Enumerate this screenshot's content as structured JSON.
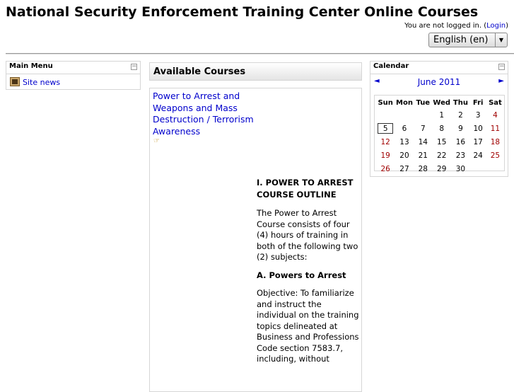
{
  "header": {
    "site_title": "National Security Enforcement Training Center Online Courses",
    "login_text": "You are not logged in. (",
    "login_link": "Login",
    "login_close": ")",
    "language": "English (en)"
  },
  "main_menu": {
    "title": "Main Menu",
    "items": [
      {
        "label": "Site news",
        "icon": "news-icon"
      }
    ]
  },
  "courses": {
    "header": "Available Courses",
    "course_title": "Power to Arrest and Weapons and Mass Destruction / Terrorism Awareness",
    "summary": {
      "heading": "I. POWER TO ARREST COURSE OUTLINE",
      "intro": "The Power to Arrest Course consists of four (4) hours of training in both of the following two (2) subjects:",
      "subheading": "A. Powers to Arrest",
      "objective": "Objective: To familiarize and instruct the individual on the training topics delineated at Business and Professions Code section 7583.7, including, without"
    }
  },
  "calendar": {
    "title": "Calendar",
    "month": "June 2011",
    "prev": "◄",
    "next": "►",
    "days": [
      "Sun",
      "Mon",
      "Tue",
      "Wed",
      "Thu",
      "Fri",
      "Sat"
    ],
    "weeks": [
      [
        "",
        "",
        "",
        "1",
        "2",
        "3",
        "4"
      ],
      [
        "5",
        "6",
        "7",
        "8",
        "9",
        "10",
        "11"
      ],
      [
        "12",
        "13",
        "14",
        "15",
        "16",
        "17",
        "18"
      ],
      [
        "19",
        "20",
        "21",
        "22",
        "23",
        "24",
        "25"
      ],
      [
        "26",
        "27",
        "28",
        "29",
        "30",
        "",
        ""
      ]
    ],
    "today": "5",
    "weekend_color": "#a00000"
  }
}
